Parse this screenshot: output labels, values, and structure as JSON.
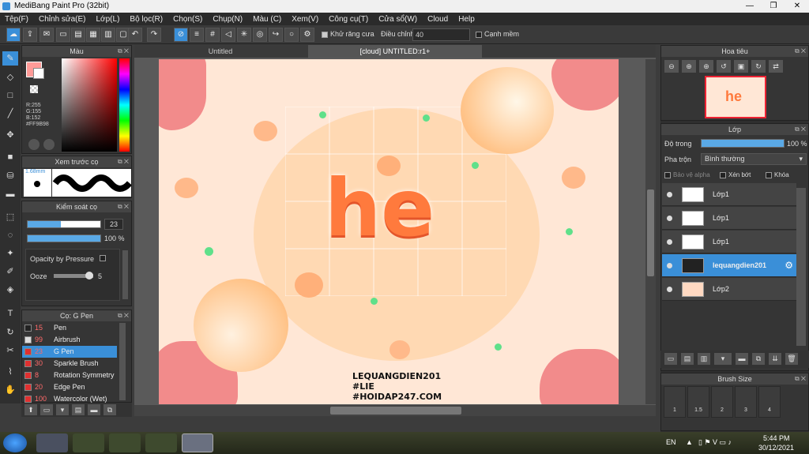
{
  "window": {
    "title": "MediBang Paint Pro (32bit)"
  },
  "menu": [
    "Tệp(F)",
    "Chỉnh sửa(E)",
    "Lớp(L)",
    "Bộ lọc(R)",
    "Chọn(S)",
    "Chụp(N)",
    "Màu (C)",
    "Xem(V)",
    "Công cụ(T)",
    "Cửa sổ(W)",
    "Cloud",
    "Help"
  ],
  "toolbar": {
    "antialias_label": "Khử răng cưa",
    "adjust_label": "Điều chỉnh",
    "adjust_value": "40",
    "sharp_label": "Cạnh mềm"
  },
  "color_panel": {
    "title": "Màu",
    "r": "R:255",
    "g": "G:155",
    "b": "B:152",
    "hex": "#FF9B98"
  },
  "preview_panel": {
    "title": "Xem trước cọ",
    "size": "1.68mm"
  },
  "brush_control": {
    "title": "Kiểm soát cọ",
    "size_value": "23",
    "opacity_value": "100 %",
    "opacity_by_pressure": "Opacity by Pressure",
    "ooze_label": "Ooze",
    "ooze_value": "5"
  },
  "brush_list": {
    "title": "Cọ: G Pen",
    "items": [
      {
        "num": "15",
        "name": "Pen",
        "color": "#222222"
      },
      {
        "num": "99",
        "name": "Airbrush",
        "color": "#dddddd"
      },
      {
        "num": "23",
        "name": "G Pen",
        "color": "#e03030"
      },
      {
        "num": "30",
        "name": "Sparkle Brush",
        "color": "#e03030"
      },
      {
        "num": "8",
        "name": "Rotation Symmetry",
        "color": "#e03030"
      },
      {
        "num": "20",
        "name": "Edge Pen",
        "color": "#e03030"
      },
      {
        "num": "100",
        "name": "Watercolor (Wet)",
        "color": "#e03030"
      }
    ]
  },
  "tabs": {
    "tab1": "Untitled",
    "tab2": "[cloud] UNTITLED:r1+"
  },
  "artwork": {
    "text1": "he",
    "footer1": "LEQUANGDIEN201",
    "footer2": "#LIE",
    "footer3": "#HOIDAP247.COM"
  },
  "navigator": {
    "title": "Hoa tiêu"
  },
  "layers": {
    "title": "Lớp",
    "opacity_label": "Độ trong",
    "opacity_value": "100 %",
    "blend_label": "Pha trộn",
    "blend_value": "Bình thường",
    "protect_alpha": "Bảo vệ alpha",
    "clip": "Xén bớt",
    "lock": "Khóa",
    "items": [
      {
        "name": "Lớp1"
      },
      {
        "name": "Lớp1"
      },
      {
        "name": "Lớp1"
      },
      {
        "name": "lequangdien201"
      },
      {
        "name": "Lớp2"
      }
    ]
  },
  "brush_size": {
    "title": "Brush Size",
    "values": [
      "1",
      "1.5",
      "2",
      "3",
      "4"
    ]
  },
  "taskbar": {
    "lang": "EN",
    "time": "5:44 PM",
    "date": "30/12/2021"
  }
}
